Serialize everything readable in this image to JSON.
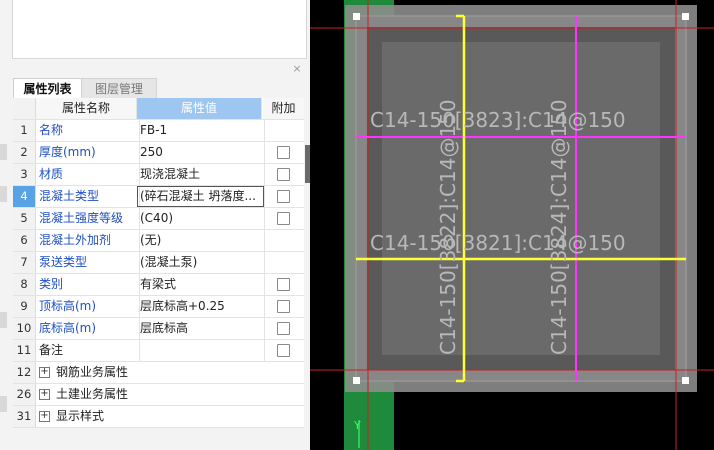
{
  "tabs": {
    "properties": "属性列表",
    "layers": "图层管理"
  },
  "close_symbol": "×",
  "header": {
    "name": "属性名称",
    "value": "属性值",
    "extra": "附加"
  },
  "rows": [
    {
      "num": "1",
      "name": "名称",
      "value": "FB-1",
      "checkbox": false
    },
    {
      "num": "2",
      "name": "厚度(mm)",
      "value": "250",
      "checkbox": true
    },
    {
      "num": "3",
      "name": "材质",
      "value": "现浇混凝土",
      "checkbox": true
    },
    {
      "num": "4",
      "name": "混凝土类型",
      "value": "(碎石混凝土 坍落度...",
      "checkbox": true
    },
    {
      "num": "5",
      "name": "混凝土强度等级",
      "value": "(C40)",
      "checkbox": true
    },
    {
      "num": "6",
      "name": "混凝土外加剂",
      "value": "(无)",
      "checkbox": false
    },
    {
      "num": "7",
      "name": "泵送类型",
      "value": "(混凝土泵)",
      "checkbox": false
    },
    {
      "num": "8",
      "name": "类别",
      "value": "有梁式",
      "checkbox": true
    },
    {
      "num": "9",
      "name": "顶标高(m)",
      "value": "层底标高+0.25",
      "checkbox": true
    },
    {
      "num": "10",
      "name": "底标高(m)",
      "value": "层底标高",
      "checkbox": true
    },
    {
      "num": "11",
      "name": "备注",
      "value": "",
      "checkbox": true
    }
  ],
  "groups": [
    {
      "num": "12",
      "label": "钢筋业务属性",
      "expander": "+"
    },
    {
      "num": "26",
      "label": "土建业务属性",
      "expander": "+"
    },
    {
      "num": "31",
      "label": "显示样式",
      "expander": "+"
    }
  ],
  "canvas": {
    "labels": {
      "top_horizontal": "C14-150[3823]:C14@150",
      "mid_horizontal": "C14-150[3821]:C14@150",
      "left_vertical": "C14-150[3822]:C14@150",
      "right_vertical": "C14-150[3824]:C14@150"
    },
    "axis_label": "Y",
    "colors": {
      "background": "#000000",
      "slab_fill": "#595959",
      "slab_inner": "#6b6b6b",
      "rebar_yellow": "#ffff33",
      "rebar_magenta": "#ff33ff",
      "grid_red": "#cc1f1f",
      "green_bar": "#1f8a3b",
      "border_white": "#ffffff"
    }
  }
}
